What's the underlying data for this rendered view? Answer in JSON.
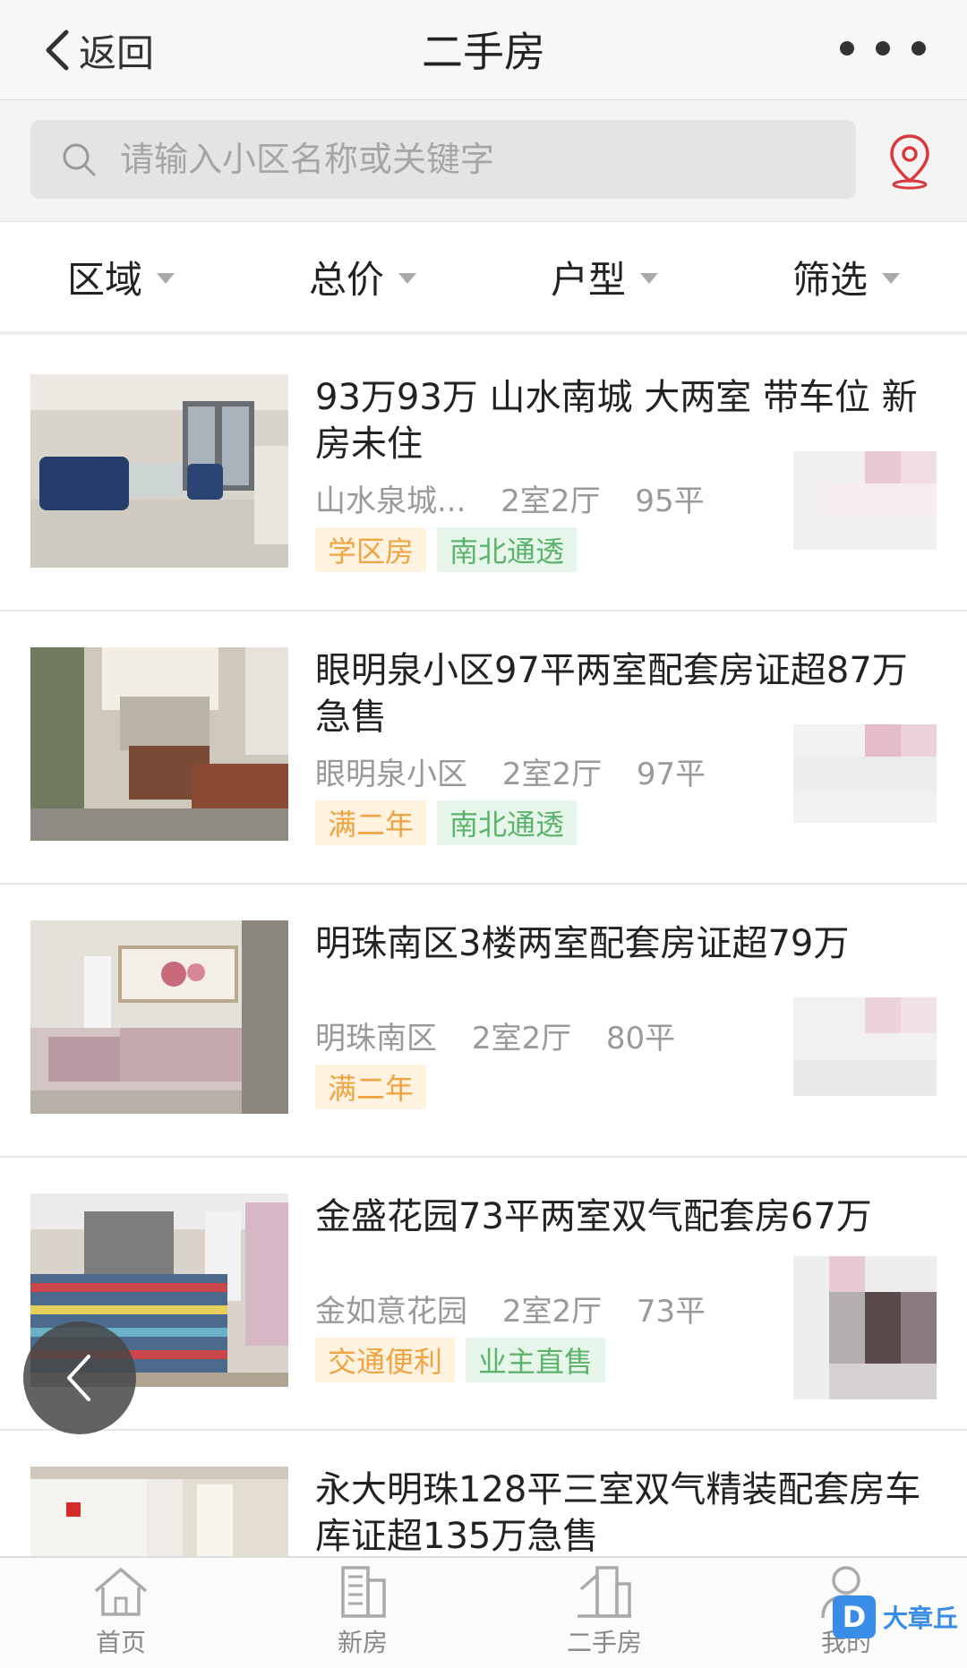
{
  "navbar": {
    "back_label": "返回",
    "title": "二手房"
  },
  "search": {
    "placeholder": "请输入小区名称或关键字"
  },
  "filters": [
    {
      "label": "区域"
    },
    {
      "label": "总价"
    },
    {
      "label": "户型"
    },
    {
      "label": "筛选"
    }
  ],
  "listings": [
    {
      "title": "93万93万 山水南城 大两室 带车位 新房未住",
      "community": "山水泉城...",
      "layout": "2室2厅",
      "area": "95平",
      "tags": [
        {
          "text": "学区房",
          "color": "orange"
        },
        {
          "text": "南北通透",
          "color": "green"
        }
      ]
    },
    {
      "title": "眼明泉小区97平两室配套房证超87万急售",
      "community": "眼明泉小区",
      "layout": "2室2厅",
      "area": "97平",
      "tags": [
        {
          "text": "满二年",
          "color": "orange"
        },
        {
          "text": "南北通透",
          "color": "green"
        }
      ]
    },
    {
      "title": "明珠南区3楼两室配套房证超79万",
      "community": "明珠南区",
      "layout": "2室2厅",
      "area": "80平",
      "tags": [
        {
          "text": "满二年",
          "color": "orange"
        }
      ]
    },
    {
      "title": "金盛花园73平两室双气配套房67万",
      "community": "金如意花园",
      "layout": "2室2厅",
      "area": "73平",
      "tags": [
        {
          "text": "交通便利",
          "color": "orange"
        },
        {
          "text": "业主直售",
          "color": "green"
        }
      ]
    },
    {
      "title": "永大明珠128平三室双气精装配套房车库证超135万急售",
      "community": "",
      "layout": "",
      "area": "",
      "tags": []
    }
  ],
  "tabbar": [
    {
      "label": "首页",
      "icon": "home-icon"
    },
    {
      "label": "新房",
      "icon": "building-icon"
    },
    {
      "label": "二手房",
      "icon": "house-icon"
    },
    {
      "label": "我的",
      "icon": "user-icon"
    }
  ],
  "watermark": {
    "logo": "D",
    "text": "大章丘"
  },
  "colors": {
    "accent_red": "#d9393d",
    "tag_orange": "#f0a341",
    "tag_green": "#5db36c"
  }
}
